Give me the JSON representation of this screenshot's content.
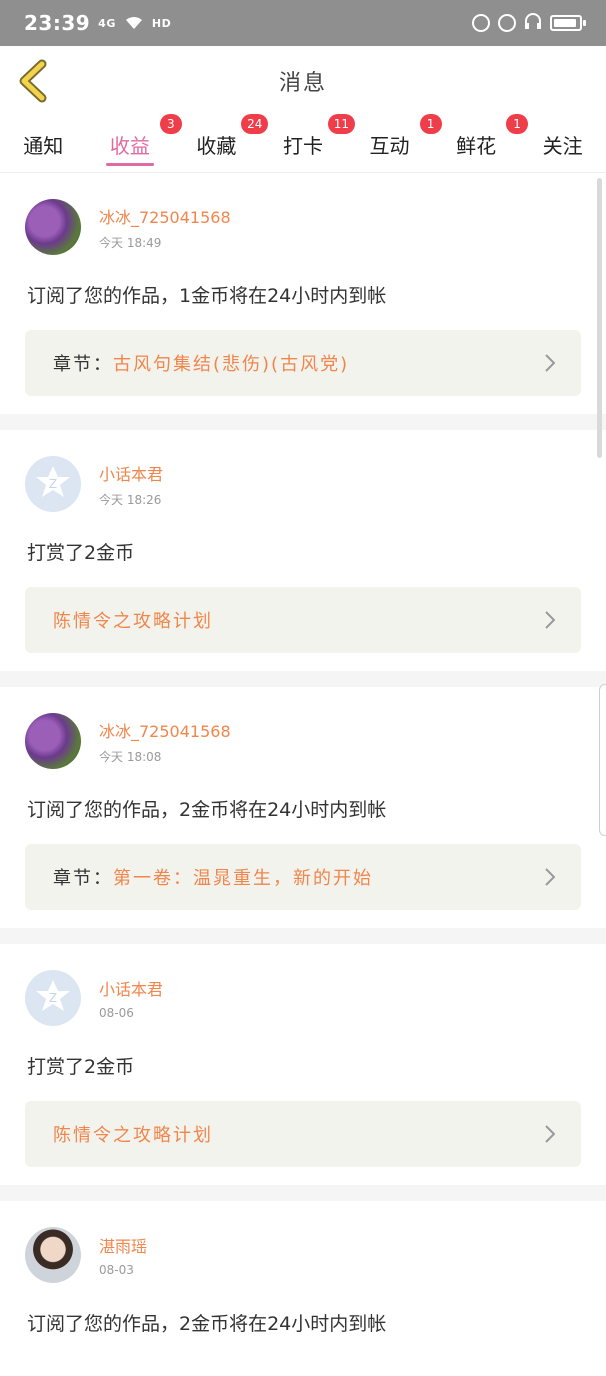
{
  "status": {
    "time": "23:39",
    "network": "4G",
    "hd": "HD"
  },
  "header": {
    "title": "消息"
  },
  "tabs": [
    {
      "label": "通知",
      "badge": ""
    },
    {
      "label": "收益",
      "badge": "3",
      "active": true
    },
    {
      "label": "收藏",
      "badge": "24"
    },
    {
      "label": "打卡",
      "badge": "11"
    },
    {
      "label": "互动",
      "badge": "1"
    },
    {
      "label": "鲜花",
      "badge": "1"
    },
    {
      "label": "关注",
      "badge": ""
    }
  ],
  "items": [
    {
      "name": "冰冰_725041568",
      "time": "今天 18:49",
      "message": "订阅了您的作品，1金币将在24小时内到帐",
      "card_label": "章节：",
      "card_value": "古风句集结(悲伤)(古风党)"
    },
    {
      "name": "小话本君",
      "time": "今天 18:26",
      "message": "打赏了2金币",
      "card_label": "",
      "card_value": "陈情令之攻略计划"
    },
    {
      "name": "冰冰_725041568",
      "time": "今天 18:08",
      "message": "订阅了您的作品，2金币将在24小时内到帐",
      "card_label": "章节：",
      "card_value": "第一卷：温晁重生，新的开始"
    },
    {
      "name": "小话本君",
      "time": "08-06",
      "message": "打赏了2金币",
      "card_label": "",
      "card_value": "陈情令之攻略计划"
    },
    {
      "name": "湛雨瑶",
      "time": "08-03",
      "message": "订阅了您的作品，2金币将在24小时内到帐",
      "card_label": "",
      "card_value": ""
    }
  ],
  "colors": {
    "accent_pink": "#e06aa3",
    "accent_orange": "#f0864c",
    "badge_red": "#ef3e4a"
  }
}
